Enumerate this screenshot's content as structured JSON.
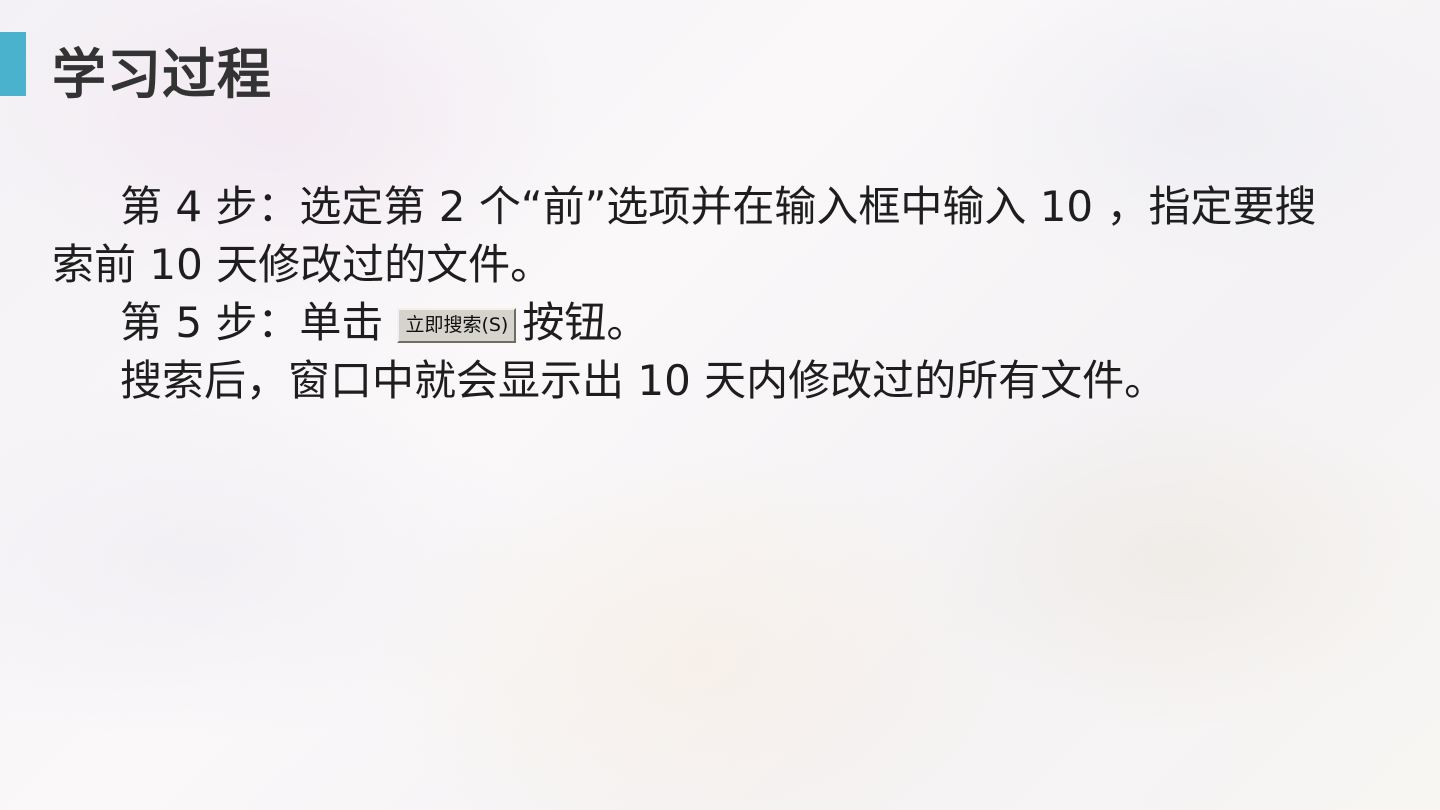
{
  "slide": {
    "title": "学习过程",
    "accent_color": "#4ab2cc"
  },
  "content": {
    "step4": "第 4 步：选定第 2 个“前”选项并在输入框中输入 10 ，指定要搜索前 10 天修改过的文件。",
    "step5_prefix": "第 5 步：单击",
    "search_now_button": "立即搜索(S)",
    "step5_suffix": "按钮。",
    "result": "搜索后，窗口中就会显示出 10 天内修改过的所有文件。"
  }
}
